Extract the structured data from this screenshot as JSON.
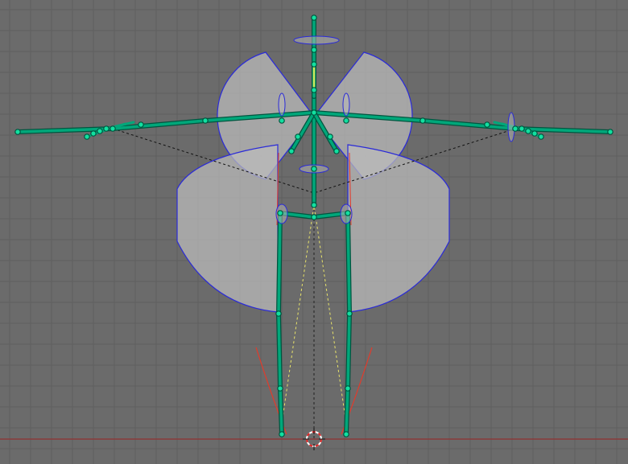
{
  "viewport": {
    "type": "3d-viewport-front-orthographic",
    "colors": {
      "background": "#6b6b6b",
      "grid_line": "#5f5f5f",
      "ground_axis": "#9a2222",
      "center_axis": "#222222",
      "bone": "#00a77a",
      "bone_outline": "#00553f",
      "bone_joint": "#12e0a0",
      "active_bone": "#c8e85a",
      "ik_line": "#e8e36a",
      "limit_arc": "#e43a2a",
      "limit_sphere_fill": "#bcbcbc",
      "limit_sphere_edge": "#2a2ad8",
      "relationship_line": "#111111",
      "cursor_ring_red": "#e02020",
      "cursor_ring_white": "#ffffff"
    },
    "objects": {
      "armature": "armature-rig",
      "rotation_limits": "bone-rotation-limit-spheres",
      "cursor": "3d-cursor"
    }
  }
}
